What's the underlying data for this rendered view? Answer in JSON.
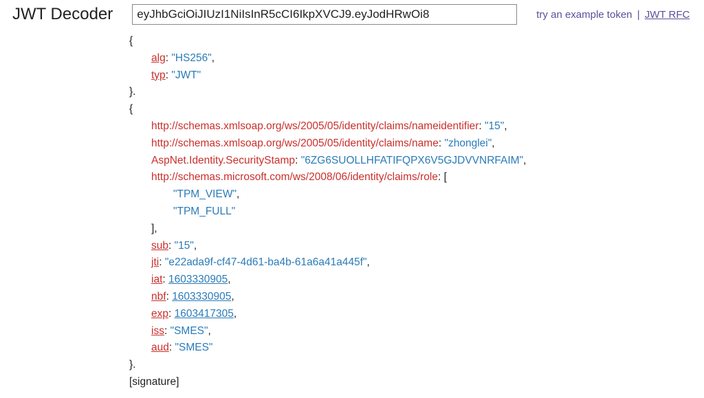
{
  "title": "JWT Decoder",
  "tokenInput": "eyJhbGciOiJIUzI1NiIsInR5cCI6IkpXVCJ9.eyJodHRwOi8",
  "links": {
    "example": "try an example token",
    "rfc": "JWT RFC"
  },
  "decoded": {
    "openBrace": "{",
    "closeBrace": "}",
    "closeBraceDot": "}.",
    "openBracket": "[",
    "closeBracket": "]",
    "closeBracketComma": "],",
    "colon": ": ",
    "comma": ",",
    "header": {
      "alg": {
        "key": "alg",
        "value": "\"HS256\""
      },
      "typ": {
        "key": "typ",
        "value": "\"JWT\""
      }
    },
    "payload": {
      "nameid": {
        "key": "http://schemas.xmlsoap.org/ws/2005/05/identity/claims/nameidentifier",
        "value": "\"15\""
      },
      "name": {
        "key": "http://schemas.xmlsoap.org/ws/2005/05/identity/claims/name",
        "value": "\"zhonglei\""
      },
      "stamp": {
        "key": "AspNet.Identity.SecurityStamp",
        "value": "\"6ZG6SUOLLHFATIFQPX6V5GJDVVNRFAIM\""
      },
      "role": {
        "key": "http://schemas.microsoft.com/ws/2008/06/identity/claims/role"
      },
      "roleArr": {
        "v1": "\"TPM_VIEW\"",
        "v2": "\"TPM_FULL\""
      },
      "sub": {
        "key": "sub",
        "value": "\"15\""
      },
      "jti": {
        "key": "jti",
        "value": "\"e22ada9f-cf47-4d61-ba4b-61a6a41a445f\""
      },
      "iat": {
        "key": "iat",
        "value": "1603330905"
      },
      "nbf": {
        "key": "nbf",
        "value": "1603330905"
      },
      "exp": {
        "key": "exp",
        "value": "1603417305"
      },
      "iss": {
        "key": "iss",
        "value": "\"SMES\""
      },
      "aud": {
        "key": "aud",
        "value": "\"SMES\""
      }
    },
    "signature": "[signature]"
  }
}
